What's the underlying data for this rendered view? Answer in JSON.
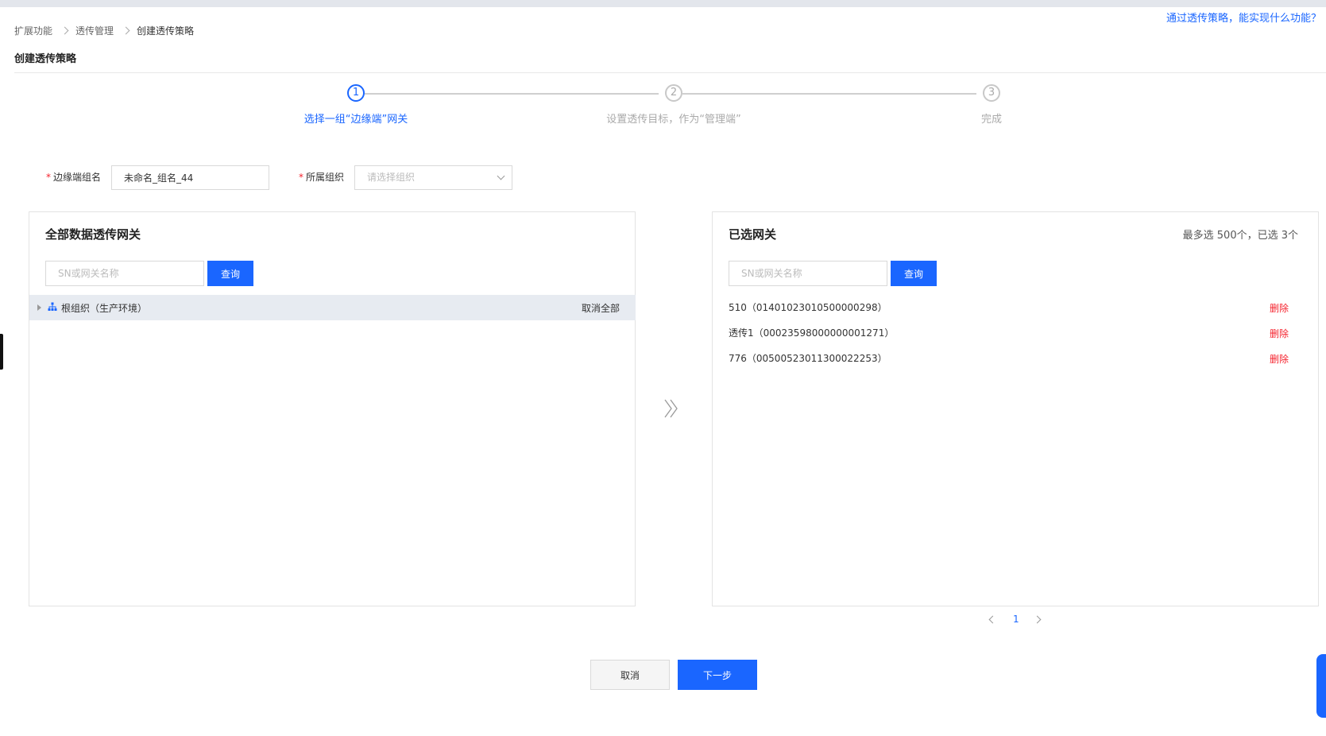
{
  "header": {
    "help_link": "通过透传策略，能实现什么功能？",
    "breadcrumb": [
      "扩展功能",
      "透传管理",
      "创建透传策略"
    ],
    "page_title": "创建透传策略"
  },
  "steps": [
    {
      "index": "1",
      "label": "选择一组“边缘端”网关",
      "active": true
    },
    {
      "index": "2",
      "label": "设置透传目标，作为“管理端”",
      "active": false
    },
    {
      "index": "3",
      "label": "完成",
      "active": false
    }
  ],
  "form": {
    "group_name_label": "边缘端组名",
    "group_name_value": "未命名_组名_44",
    "org_label": "所属组织",
    "org_placeholder": "请选择组织"
  },
  "left_panel": {
    "title": "全部数据透传网关",
    "search_placeholder": "SN或网关名称",
    "search_button": "查询",
    "tree_root_label": "根组织（生产环境）",
    "cancel_all": "取消全部"
  },
  "right_panel": {
    "title": "已选网关",
    "count_text": "最多选 500个，已选 3个",
    "search_placeholder": "SN或网关名称",
    "search_button": "查询",
    "items": [
      {
        "label": "510（01401023010500000298）",
        "action": "删除"
      },
      {
        "label": "透传1（00023598000000001271）",
        "action": "删除"
      },
      {
        "label": "776（00500523011300022253）",
        "action": "删除"
      }
    ]
  },
  "pagination": {
    "current": "1"
  },
  "footer": {
    "cancel": "取消",
    "next": "下一步"
  },
  "colors": {
    "primary": "#1a66ff",
    "danger": "#f5222d"
  }
}
